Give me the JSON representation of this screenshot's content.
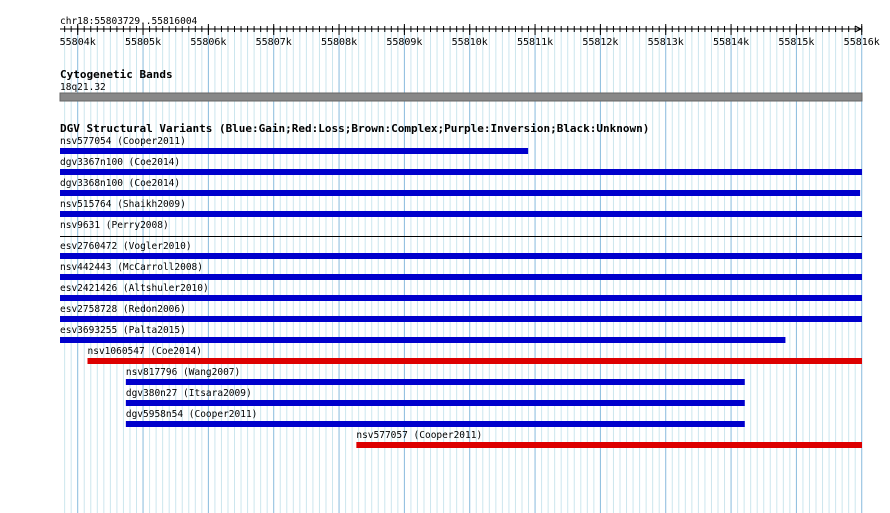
{
  "region": {
    "label": "chr18:55803729..55816004",
    "start": 55803729,
    "end": 55816004
  },
  "ruler": {
    "ticks": [
      {
        "label": "55804k",
        "pos": 55804000
      },
      {
        "label": "55805k",
        "pos": 55805000
      },
      {
        "label": "55806k",
        "pos": 55806000
      },
      {
        "label": "55807k",
        "pos": 55807000
      },
      {
        "label": "55808k",
        "pos": 55808000
      },
      {
        "label": "55809k",
        "pos": 55809000
      },
      {
        "label": "55810k",
        "pos": 55810000
      },
      {
        "label": "55811k",
        "pos": 55811000
      },
      {
        "label": "55812k",
        "pos": 55812000
      },
      {
        "label": "55813k",
        "pos": 55813000
      },
      {
        "label": "55814k",
        "pos": 55814000
      },
      {
        "label": "55815k",
        "pos": 55815000
      },
      {
        "label": "55816k",
        "pos": 55816000
      }
    ]
  },
  "cytoband_track": {
    "title": "Cytogenetic Bands",
    "band": "18q21.32"
  },
  "dgv_track": {
    "title": "DGV Structural Variants (Blue:Gain;Red:Loss;Brown:Complex;Purple:Inversion;Black:Unknown)",
    "colors": {
      "gain": "#0000cc",
      "loss": "#dd0000",
      "unknown": "#000000"
    },
    "features": [
      {
        "label": "nsv577054 (Cooper2011)",
        "type": "gain",
        "start": 55803729,
        "end": 55810894
      },
      {
        "label": "dgv3367n100 (Coe2014)",
        "type": "gain",
        "start": 55803729,
        "end": 55816004
      },
      {
        "label": "dgv3368n100 (Coe2014)",
        "type": "gain",
        "start": 55803729,
        "end": 55815975
      },
      {
        "label": "nsv515764 (Shaikh2009)",
        "type": "gain",
        "start": 55803729,
        "end": 55816004
      },
      {
        "label": "nsv9631 (Perry2008)",
        "type": "unknown",
        "start": 55803729,
        "end": 55816004
      },
      {
        "label": "esv2760472 (Vogler2010)",
        "type": "gain",
        "start": 55803729,
        "end": 55816004
      },
      {
        "label": "nsv442443 (McCarroll2008)",
        "type": "gain",
        "start": 55803729,
        "end": 55816004
      },
      {
        "label": "esv2421426 (Altshuler2010)",
        "type": "gain",
        "start": 55803729,
        "end": 55816004
      },
      {
        "label": "esv2758728 (Redon2006)",
        "type": "gain",
        "start": 55803729,
        "end": 55816004
      },
      {
        "label": "esv3693255 (Palta2015)",
        "type": "gain",
        "start": 55803729,
        "end": 55814832
      },
      {
        "label": "nsv1060547 (Coe2014)",
        "type": "loss",
        "start": 55804150,
        "end": 55816004
      },
      {
        "label": "nsv817796 (Wang2007)",
        "type": "gain",
        "start": 55804737,
        "end": 55814210
      },
      {
        "label": "dgv380n27 (Itsara2009)",
        "type": "gain",
        "start": 55804737,
        "end": 55814210
      },
      {
        "label": "dgv5958n54 (Cooper2011)",
        "type": "gain",
        "start": 55804737,
        "end": 55814210
      },
      {
        "label": "nsv577057 (Cooper2011)",
        "type": "loss",
        "start": 55808265,
        "end": 55816004
      }
    ]
  }
}
